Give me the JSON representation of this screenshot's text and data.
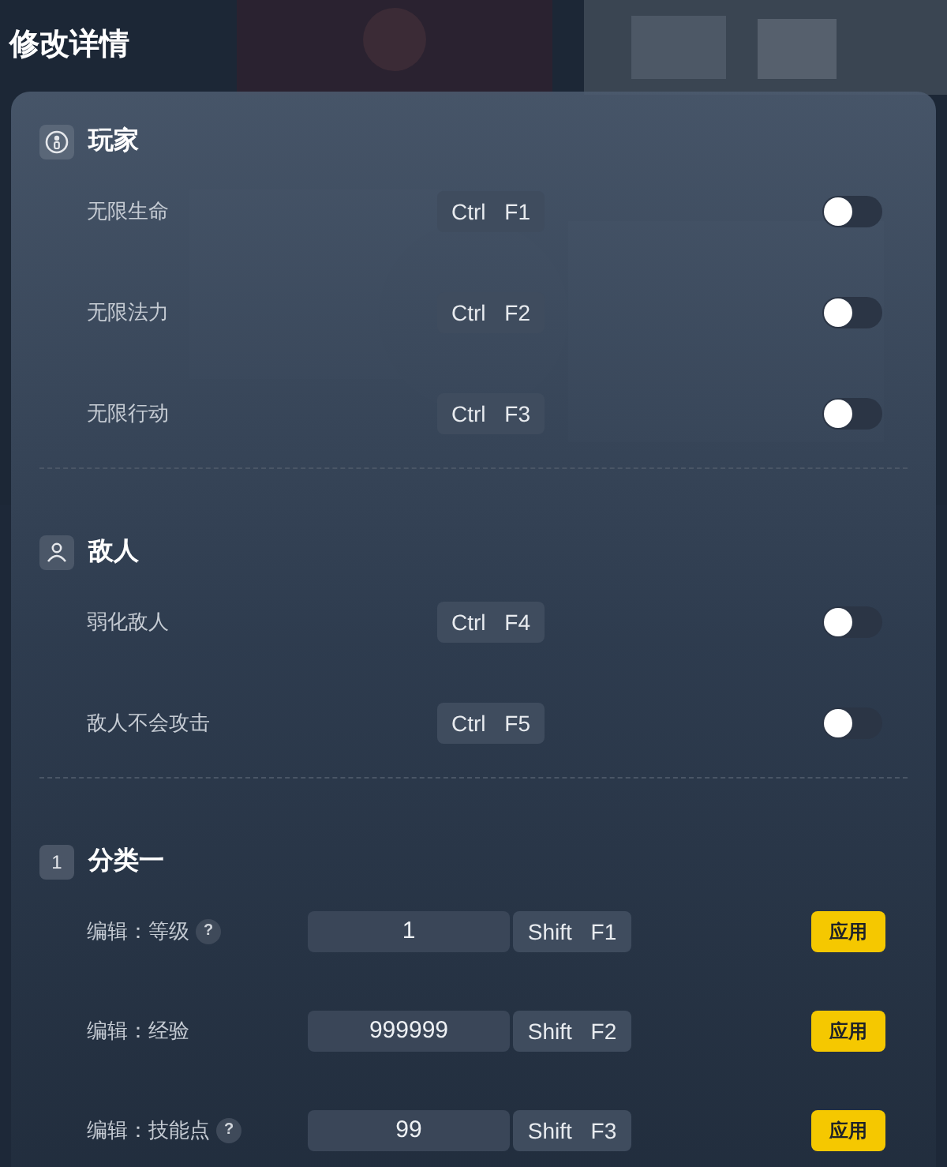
{
  "title": "修改详情",
  "sections": [
    {
      "title": "玩家",
      "kind": "player",
      "rows": [
        {
          "kind": "toggle",
          "label": "无限生命",
          "hotkey": "Ctrl F1",
          "on": false
        },
        {
          "kind": "toggle",
          "label": "无限法力",
          "hotkey": "Ctrl F2",
          "on": false
        },
        {
          "kind": "toggle",
          "label": "无限行动",
          "hotkey": "Ctrl F3",
          "on": false
        }
      ]
    },
    {
      "title": "敌人",
      "kind": "enemy",
      "rows": [
        {
          "kind": "toggle",
          "label": "弱化敌人",
          "hotkey": "Ctrl F4",
          "on": false
        },
        {
          "kind": "toggle",
          "label": "敌人不会攻击",
          "hotkey": "Ctrl F5",
          "on": false
        }
      ]
    },
    {
      "title": "分类一",
      "kind": "number",
      "number": "1",
      "rows": [
        {
          "kind": "edit",
          "label": "编辑：等级",
          "help": "?",
          "value": "1",
          "hotkey": "Shift F1",
          "button": "应用"
        },
        {
          "kind": "edit",
          "label": "编辑：经验",
          "value": "999999",
          "hotkey": "Shift F2",
          "button": "应用"
        },
        {
          "kind": "edit",
          "label": "编辑：技能点",
          "help": "?",
          "value": "99",
          "hotkey": "Shift F3",
          "button": "应用"
        }
      ]
    }
  ]
}
